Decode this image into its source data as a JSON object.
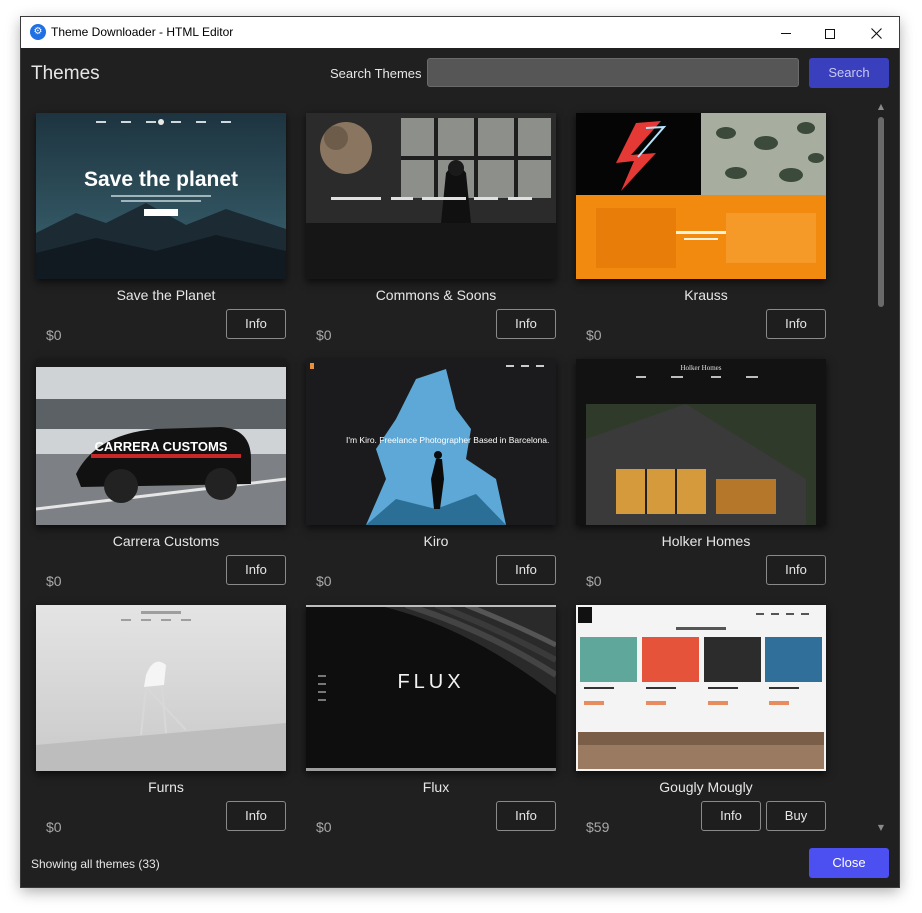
{
  "window": {
    "title": "Theme Downloader - HTML Editor"
  },
  "header": {
    "heading": "Themes",
    "search_label": "Search Themes",
    "search_value": "",
    "search_button": "Search"
  },
  "themes": [
    {
      "name": "Save the Planet",
      "price": "$0",
      "info": "Info",
      "thumb_text": "Save the planet"
    },
    {
      "name": "Commons & Soons",
      "price": "$0",
      "info": "Info",
      "thumb_text": ""
    },
    {
      "name": "Krauss",
      "price": "$0",
      "info": "Info",
      "thumb_text": ""
    },
    {
      "name": "Carrera Customs",
      "price": "$0",
      "info": "Info",
      "thumb_text": "CARRERA CUSTOMS"
    },
    {
      "name": "Kiro",
      "price": "$0",
      "info": "Info",
      "thumb_text": "I'm Kiro. Freelance Photographer Based in Barcelona."
    },
    {
      "name": "Holker Homes",
      "price": "$0",
      "info": "Info",
      "thumb_text": "Holker Homes"
    },
    {
      "name": "Furns",
      "price": "$0",
      "info": "Info",
      "thumb_text": ""
    },
    {
      "name": "Flux",
      "price": "$0",
      "info": "Info",
      "thumb_text": "FLUX"
    },
    {
      "name": "Gougly Mougly",
      "price": "$59",
      "info": "Info",
      "buy": "Buy",
      "thumb_text": ""
    }
  ],
  "footer": {
    "status": "Showing all themes (33)",
    "close_button": "Close"
  },
  "colors": {
    "background": "#202020",
    "accent": "#4c50f0",
    "search_button": "#3a3fbd"
  },
  "icons": {
    "app": "app-logo-icon",
    "minimize": "minimize-icon",
    "maximize": "maximize-icon",
    "close": "close-icon"
  }
}
